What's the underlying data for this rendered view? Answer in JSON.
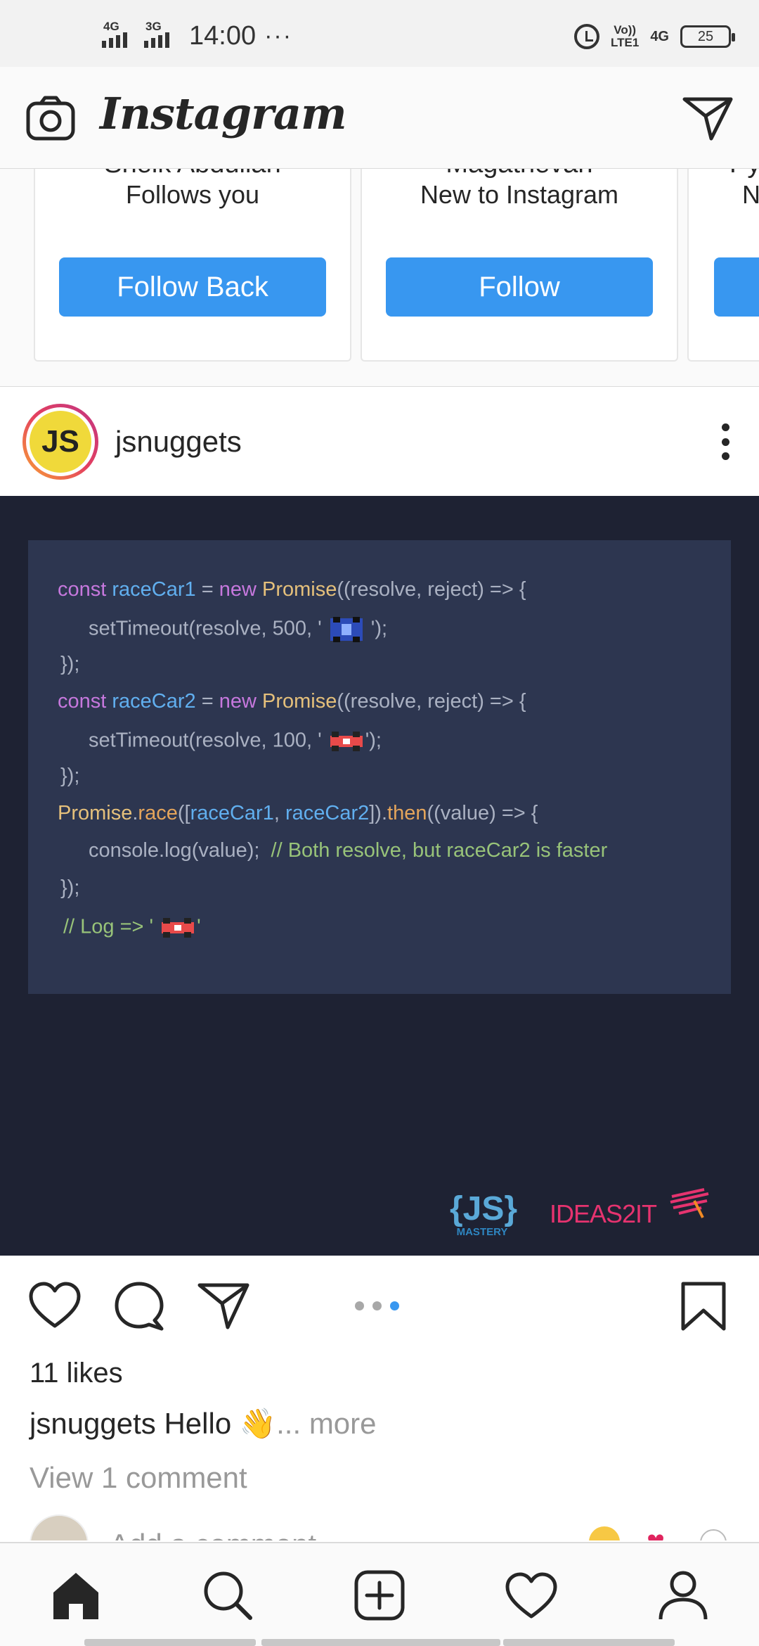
{
  "status_bar": {
    "net1": "4G",
    "net2": "3G",
    "time": "14:00",
    "dots": "···",
    "volte_top": "Vo))",
    "volte_bottom": "LTE1",
    "net_right": "4G",
    "battery": "25"
  },
  "header": {
    "logo": "Instagram",
    "icons": [
      "camera-icon",
      "direct-message-icon"
    ]
  },
  "suggestions": [
    {
      "name": "Sheik Abdullah",
      "subtitle": "Follows you",
      "button": "Follow Back"
    },
    {
      "name": "Magathevan",
      "subtitle": "New to Instagram",
      "button": "Follow"
    },
    {
      "name": "Py",
      "subtitle": "N",
      "button": ""
    }
  ],
  "post": {
    "username": "jsnuggets",
    "avatar_text": "JS",
    "code_lines": [
      "const raceCar1 = new Promise((resolve, reject) => {",
      "setTimeout(resolve, 500, ' 🏎 ');",
      "});",
      "const raceCar2 = new Promise((resolve, reject) => {",
      "setTimeout(resolve, 100, ' 🏎 ');",
      "});",
      "Promise.race([raceCar1, raceCar2]).then((value) => {",
      "console.log(value);  // Both resolve, but raceCar2 is faster",
      "});",
      "// Log => ' 🏎 '"
    ],
    "brand_left_big": "{JS}",
    "brand_left_small": "MASTERY",
    "brand_right": "IDEAS2IT",
    "carousel": {
      "total": 3,
      "active": 3
    },
    "likes": "11 likes",
    "caption_user": "jsnuggets",
    "caption_text": " Hello 👋",
    "caption_more": "... more",
    "view_comments": "View 1 comment",
    "add_comment_placeholder": "Add a comment..."
  },
  "colors": {
    "accent": "#3897f0",
    "post_bg": "#1e2233",
    "code_bg": "#2d3650"
  },
  "bottom_nav": [
    "home-icon",
    "search-icon",
    "new-post-icon",
    "activity-icon",
    "profile-icon"
  ]
}
